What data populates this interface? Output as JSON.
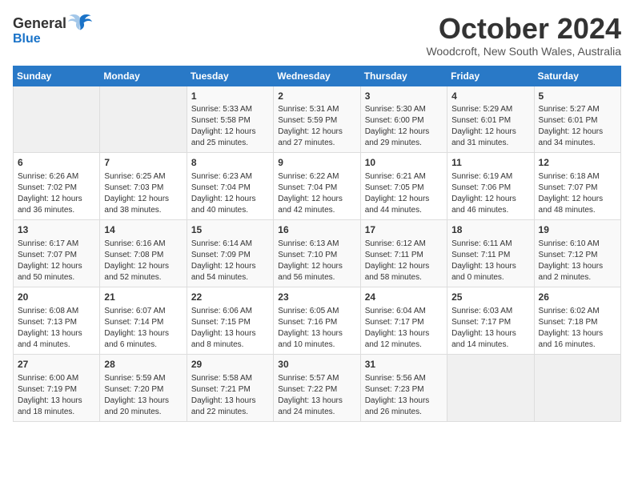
{
  "header": {
    "logo_line1": "General",
    "logo_line2": "Blue",
    "month": "October 2024",
    "location": "Woodcroft, New South Wales, Australia"
  },
  "days_of_week": [
    "Sunday",
    "Monday",
    "Tuesday",
    "Wednesday",
    "Thursday",
    "Friday",
    "Saturday"
  ],
  "weeks": [
    [
      {
        "day": "",
        "empty": true
      },
      {
        "day": "",
        "empty": true
      },
      {
        "day": "1",
        "sunrise": "Sunrise: 5:33 AM",
        "sunset": "Sunset: 5:58 PM",
        "daylight": "Daylight: 12 hours and 25 minutes."
      },
      {
        "day": "2",
        "sunrise": "Sunrise: 5:31 AM",
        "sunset": "Sunset: 5:59 PM",
        "daylight": "Daylight: 12 hours and 27 minutes."
      },
      {
        "day": "3",
        "sunrise": "Sunrise: 5:30 AM",
        "sunset": "Sunset: 6:00 PM",
        "daylight": "Daylight: 12 hours and 29 minutes."
      },
      {
        "day": "4",
        "sunrise": "Sunrise: 5:29 AM",
        "sunset": "Sunset: 6:01 PM",
        "daylight": "Daylight: 12 hours and 31 minutes."
      },
      {
        "day": "5",
        "sunrise": "Sunrise: 5:27 AM",
        "sunset": "Sunset: 6:01 PM",
        "daylight": "Daylight: 12 hours and 34 minutes."
      }
    ],
    [
      {
        "day": "6",
        "sunrise": "Sunrise: 6:26 AM",
        "sunset": "Sunset: 7:02 PM",
        "daylight": "Daylight: 12 hours and 36 minutes."
      },
      {
        "day": "7",
        "sunrise": "Sunrise: 6:25 AM",
        "sunset": "Sunset: 7:03 PM",
        "daylight": "Daylight: 12 hours and 38 minutes."
      },
      {
        "day": "8",
        "sunrise": "Sunrise: 6:23 AM",
        "sunset": "Sunset: 7:04 PM",
        "daylight": "Daylight: 12 hours and 40 minutes."
      },
      {
        "day": "9",
        "sunrise": "Sunrise: 6:22 AM",
        "sunset": "Sunset: 7:04 PM",
        "daylight": "Daylight: 12 hours and 42 minutes."
      },
      {
        "day": "10",
        "sunrise": "Sunrise: 6:21 AM",
        "sunset": "Sunset: 7:05 PM",
        "daylight": "Daylight: 12 hours and 44 minutes."
      },
      {
        "day": "11",
        "sunrise": "Sunrise: 6:19 AM",
        "sunset": "Sunset: 7:06 PM",
        "daylight": "Daylight: 12 hours and 46 minutes."
      },
      {
        "day": "12",
        "sunrise": "Sunrise: 6:18 AM",
        "sunset": "Sunset: 7:07 PM",
        "daylight": "Daylight: 12 hours and 48 minutes."
      }
    ],
    [
      {
        "day": "13",
        "sunrise": "Sunrise: 6:17 AM",
        "sunset": "Sunset: 7:07 PM",
        "daylight": "Daylight: 12 hours and 50 minutes."
      },
      {
        "day": "14",
        "sunrise": "Sunrise: 6:16 AM",
        "sunset": "Sunset: 7:08 PM",
        "daylight": "Daylight: 12 hours and 52 minutes."
      },
      {
        "day": "15",
        "sunrise": "Sunrise: 6:14 AM",
        "sunset": "Sunset: 7:09 PM",
        "daylight": "Daylight: 12 hours and 54 minutes."
      },
      {
        "day": "16",
        "sunrise": "Sunrise: 6:13 AM",
        "sunset": "Sunset: 7:10 PM",
        "daylight": "Daylight: 12 hours and 56 minutes."
      },
      {
        "day": "17",
        "sunrise": "Sunrise: 6:12 AM",
        "sunset": "Sunset: 7:11 PM",
        "daylight": "Daylight: 12 hours and 58 minutes."
      },
      {
        "day": "18",
        "sunrise": "Sunrise: 6:11 AM",
        "sunset": "Sunset: 7:11 PM",
        "daylight": "Daylight: 13 hours and 0 minutes."
      },
      {
        "day": "19",
        "sunrise": "Sunrise: 6:10 AM",
        "sunset": "Sunset: 7:12 PM",
        "daylight": "Daylight: 13 hours and 2 minutes."
      }
    ],
    [
      {
        "day": "20",
        "sunrise": "Sunrise: 6:08 AM",
        "sunset": "Sunset: 7:13 PM",
        "daylight": "Daylight: 13 hours and 4 minutes."
      },
      {
        "day": "21",
        "sunrise": "Sunrise: 6:07 AM",
        "sunset": "Sunset: 7:14 PM",
        "daylight": "Daylight: 13 hours and 6 minutes."
      },
      {
        "day": "22",
        "sunrise": "Sunrise: 6:06 AM",
        "sunset": "Sunset: 7:15 PM",
        "daylight": "Daylight: 13 hours and 8 minutes."
      },
      {
        "day": "23",
        "sunrise": "Sunrise: 6:05 AM",
        "sunset": "Sunset: 7:16 PM",
        "daylight": "Daylight: 13 hours and 10 minutes."
      },
      {
        "day": "24",
        "sunrise": "Sunrise: 6:04 AM",
        "sunset": "Sunset: 7:17 PM",
        "daylight": "Daylight: 13 hours and 12 minutes."
      },
      {
        "day": "25",
        "sunrise": "Sunrise: 6:03 AM",
        "sunset": "Sunset: 7:17 PM",
        "daylight": "Daylight: 13 hours and 14 minutes."
      },
      {
        "day": "26",
        "sunrise": "Sunrise: 6:02 AM",
        "sunset": "Sunset: 7:18 PM",
        "daylight": "Daylight: 13 hours and 16 minutes."
      }
    ],
    [
      {
        "day": "27",
        "sunrise": "Sunrise: 6:00 AM",
        "sunset": "Sunset: 7:19 PM",
        "daylight": "Daylight: 13 hours and 18 minutes."
      },
      {
        "day": "28",
        "sunrise": "Sunrise: 5:59 AM",
        "sunset": "Sunset: 7:20 PM",
        "daylight": "Daylight: 13 hours and 20 minutes."
      },
      {
        "day": "29",
        "sunrise": "Sunrise: 5:58 AM",
        "sunset": "Sunset: 7:21 PM",
        "daylight": "Daylight: 13 hours and 22 minutes."
      },
      {
        "day": "30",
        "sunrise": "Sunrise: 5:57 AM",
        "sunset": "Sunset: 7:22 PM",
        "daylight": "Daylight: 13 hours and 24 minutes."
      },
      {
        "day": "31",
        "sunrise": "Sunrise: 5:56 AM",
        "sunset": "Sunset: 7:23 PM",
        "daylight": "Daylight: 13 hours and 26 minutes."
      },
      {
        "day": "",
        "empty": true
      },
      {
        "day": "",
        "empty": true
      }
    ]
  ]
}
